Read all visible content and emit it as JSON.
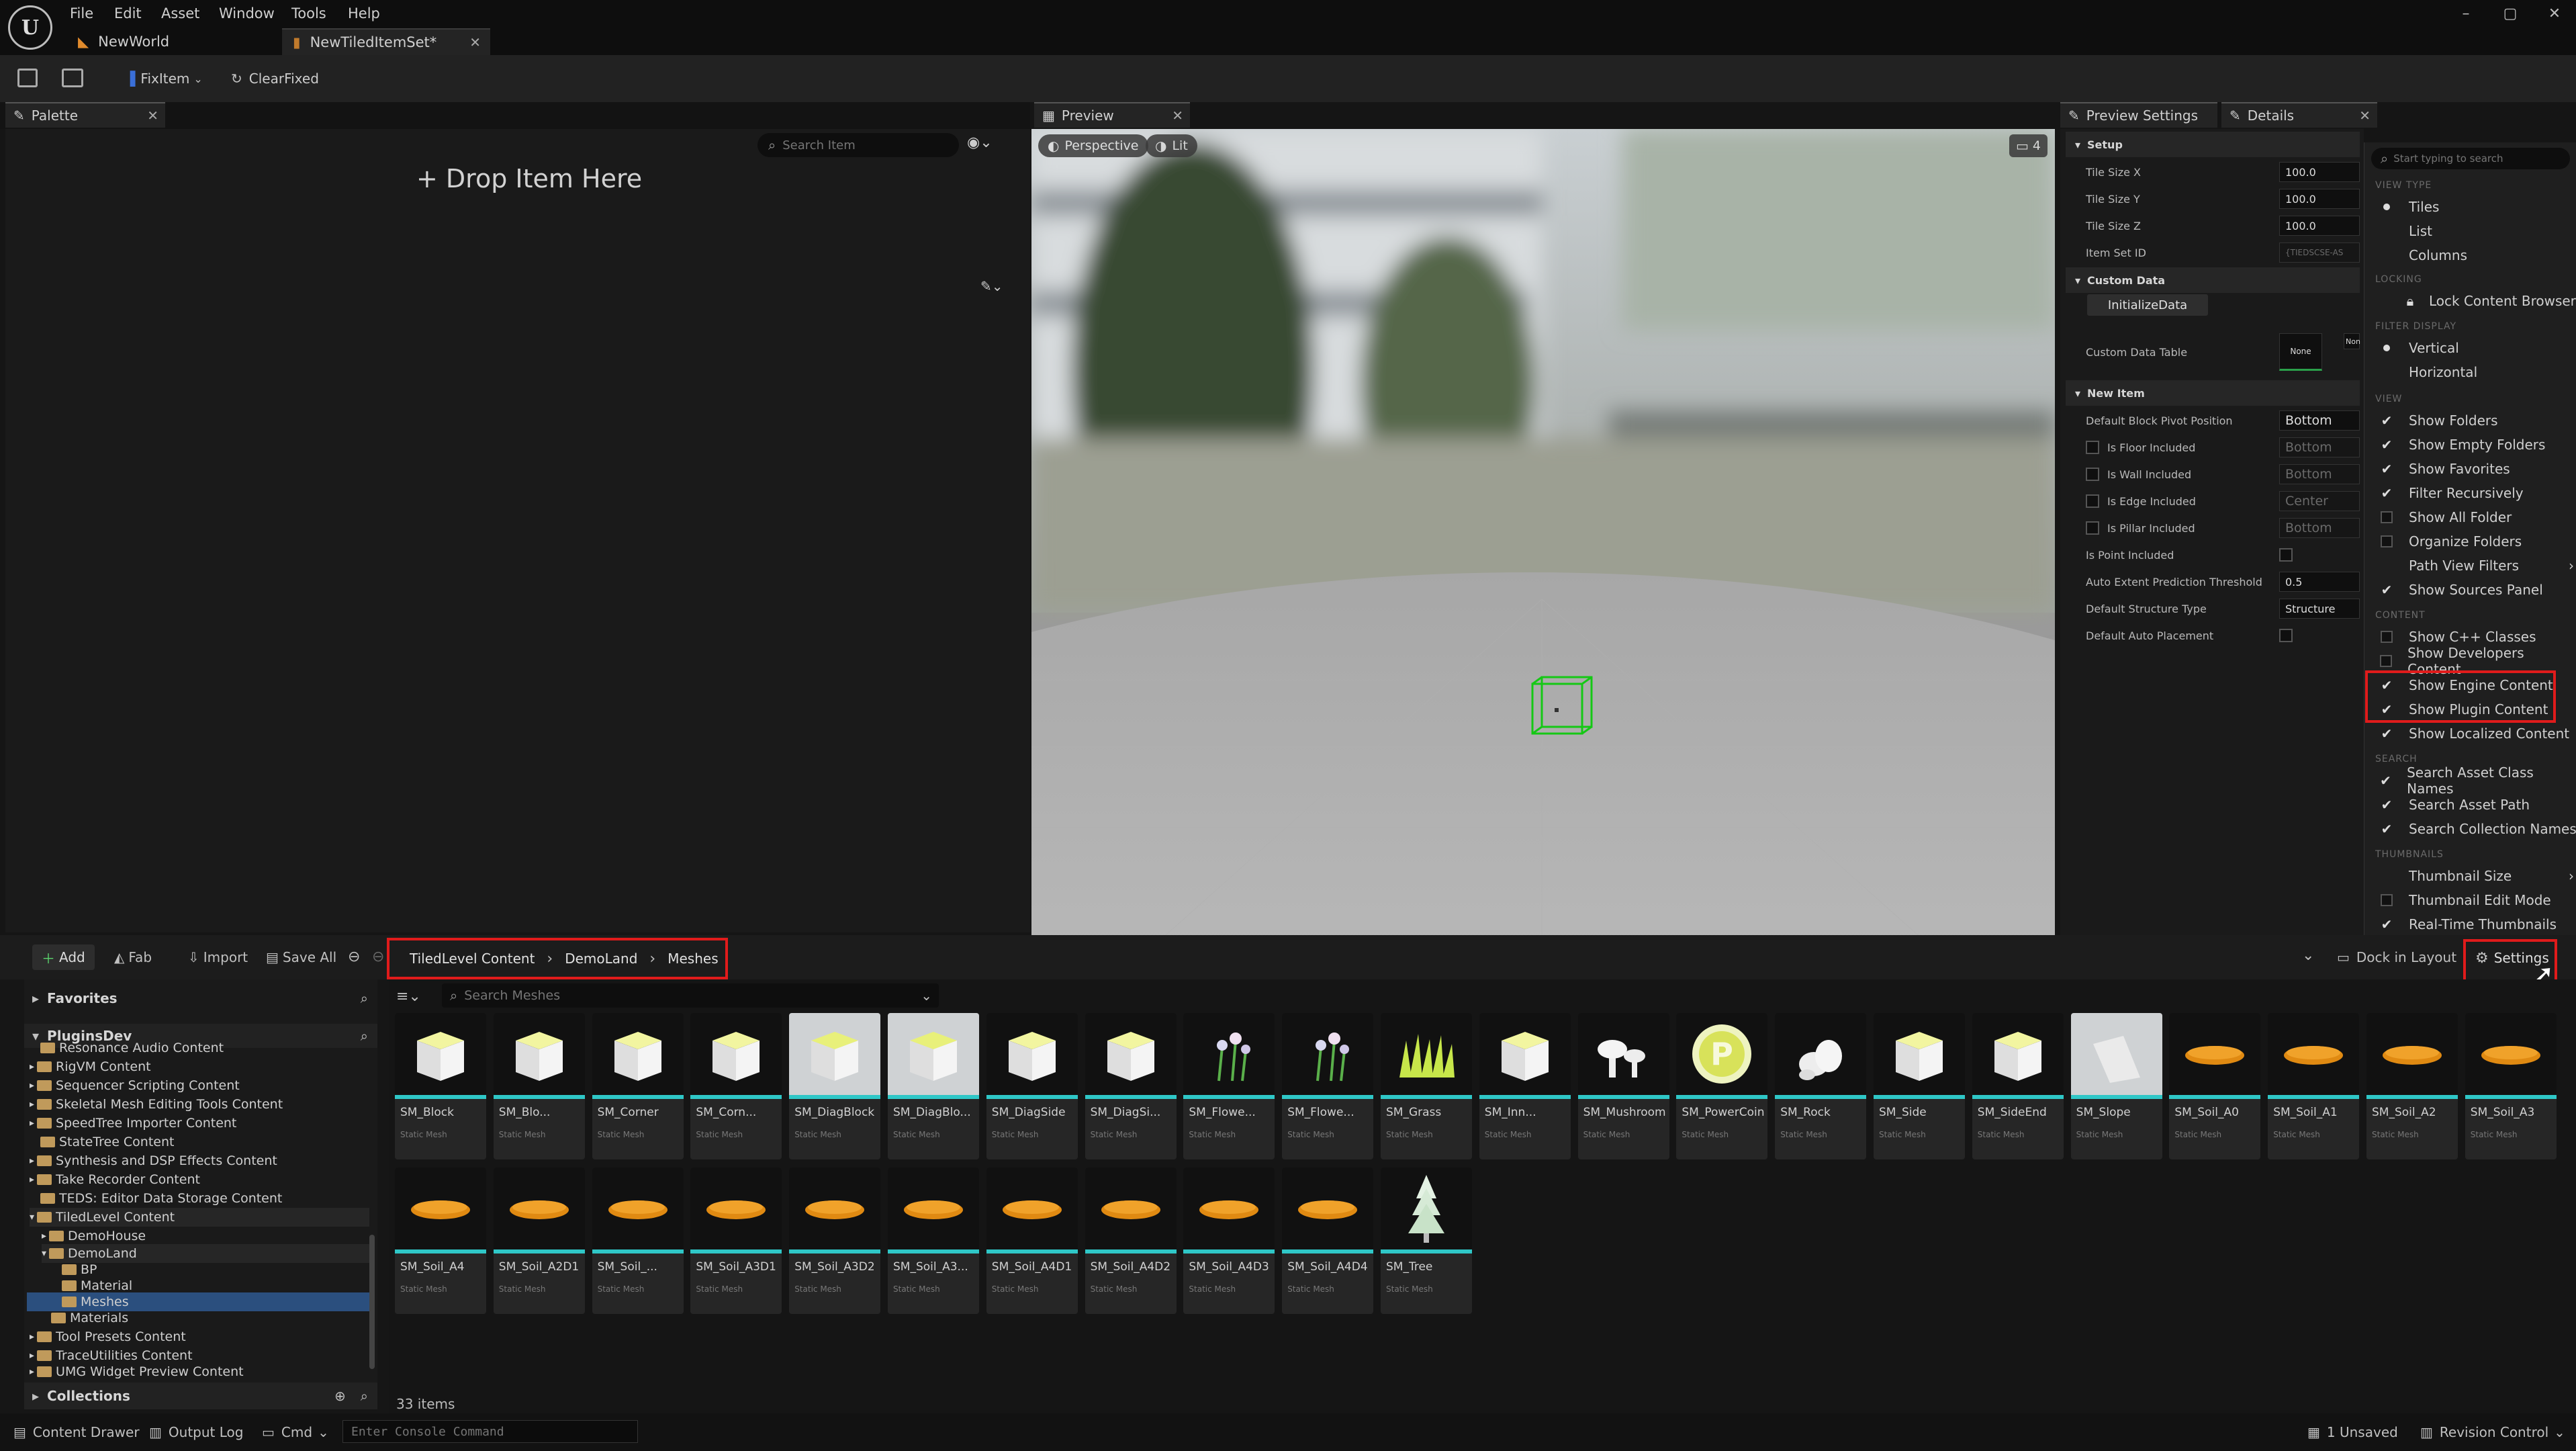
{
  "menu": [
    "File",
    "Edit",
    "Asset",
    "Window",
    "Tools",
    "Help"
  ],
  "doc_tabs": [
    {
      "label": "NewWorld"
    },
    {
      "label": "NewTiledItemSet*"
    }
  ],
  "toolbar": {
    "fix_item": "FixItem",
    "clear_fixed": "ClearFixed"
  },
  "palette": {
    "tab": "Palette",
    "search_placeholder": "Search Item",
    "drop_label": "+ Drop Item Here"
  },
  "preview": {
    "tab": "Preview",
    "perspective": "Perspective",
    "lit": "Lit",
    "camera_speed": "4"
  },
  "details": {
    "tab_preview_settings": "Preview Settings",
    "tab_details": "Details",
    "sections": {
      "setup": "Setup",
      "custom_data": "Custom Data",
      "new_item": "New Item"
    },
    "rows": {
      "tile_size_x": {
        "label": "Tile Size X",
        "value": "100.0"
      },
      "tile_size_y": {
        "label": "Tile Size Y",
        "value": "100.0"
      },
      "tile_size_z": {
        "label": "Tile Size Z",
        "value": "100.0"
      },
      "item_set_id": {
        "label": "Item Set ID",
        "value": "{TIEDSCSE-AS"
      },
      "initialize": "InitializeData",
      "custom_data_table": {
        "label": "Custom Data Table",
        "value": "None",
        "extra": "Non"
      },
      "default_block_pivot": {
        "label": "Default Block Pivot Position",
        "value": "Bottom"
      },
      "is_floor": {
        "label": "Is Floor Included",
        "value": "Bottom"
      },
      "is_wall": {
        "label": "Is Wall Included",
        "value": "Bottom"
      },
      "is_edge": {
        "label": "Is Edge Included",
        "value": "Center"
      },
      "is_pillar": {
        "label": "Is Pillar Included",
        "value": "Bottom"
      },
      "is_point": {
        "label": "Is Point Included"
      },
      "auto_extent": {
        "label": "Auto Extent Prediction Threshold",
        "value": "0.5"
      },
      "structure_type": {
        "label": "Default Structure Type",
        "value": "Structure"
      },
      "auto_placement": {
        "label": "Default Auto Placement"
      }
    }
  },
  "settings_menu": {
    "search_placeholder": "Start typing to search",
    "headers": {
      "view_type": "VIEW TYPE",
      "locking": "LOCKING",
      "filter_display": "FILTER DISPLAY",
      "view": "VIEW",
      "content": "CONTENT",
      "search": "SEARCH",
      "thumbnails": "THUMBNAILS"
    },
    "items": {
      "tiles": "Tiles",
      "list": "List",
      "columns": "Columns",
      "lock": "Lock Content Browser",
      "vertical": "Vertical",
      "horizontal": "Horizontal",
      "show_folders": "Show Folders",
      "show_empty_folders": "Show Empty Folders",
      "show_favorites": "Show Favorites",
      "filter_recursively": "Filter Recursively",
      "show_all_folder": "Show All Folder",
      "organize_folders": "Organize Folders",
      "path_view_filters": "Path View Filters",
      "show_sources_panel": "Show Sources Panel",
      "show_cpp": "Show C++ Classes",
      "show_dev": "Show Developers Content",
      "show_engine": "Show Engine Content",
      "show_plugin": "Show Plugin Content",
      "show_localized": "Show Localized Content",
      "search_class": "Search Asset Class Names",
      "search_path": "Search Asset Path",
      "search_collection": "Search Collection Names",
      "thumb_size": "Thumbnail Size",
      "thumb_edit": "Thumbnail Edit Mode",
      "realtime": "Real-Time Thumbnails"
    }
  },
  "content_browser": {
    "add": "Add",
    "fab": "Fab",
    "import": "Import",
    "save_all": "Save All",
    "breadcrumb": [
      "TiledLevel Content",
      "DemoLand",
      "Meshes"
    ],
    "dock": "Dock in Layout",
    "settings": "Settings",
    "search_placeholder": "Search Meshes",
    "favorites": "Favorites",
    "plugins_dev": "PluginsDev",
    "collections": "Collections",
    "items_count": "33 items",
    "tree": [
      "Resonance Audio Content",
      "RigVM Content",
      "Sequencer Scripting Content",
      "Skeletal Mesh Editing Tools Content",
      "SpeedTree Importer Content",
      "StateTree Content",
      "Synthesis and DSP Effects Content",
      "Take Recorder Content",
      "TEDS: Editor Data Storage Content",
      "TiledLevel Content",
      "DemoHouse",
      "DemoLand",
      "BP",
      "Material",
      "Meshes",
      "Materials",
      "Tool Presets Content",
      "TraceUtilities Content",
      "UMG Widget Preview Content"
    ],
    "asset_type": "Static Mesh",
    "assets": [
      "SM_Block",
      "SM_Blo...",
      "SM_Corner",
      "SM_Corn...",
      "SM_DiagBlock",
      "SM_DiagBlo...",
      "SM_DiagSide",
      "SM_DiagSi...",
      "SM_Flowe...",
      "SM_Flowe...",
      "SM_Grass",
      "SM_Inn...",
      "SM_Mushroom",
      "SM_PowerCoin",
      "SM_Rock",
      "SM_Side",
      "SM_SideEnd",
      "SM_Slope",
      "SM_Soil_A0",
      "SM_Soil_A1",
      "SM_Soil_A2",
      "SM_Soil_A3",
      "SM_Soil_A4",
      "SM_Soil_A2D1",
      "SM_Soil_...",
      "SM_Soil_A3D1",
      "SM_Soil_A3D2",
      "SM_Soil_A3...",
      "SM_Soil_A4D1",
      "SM_Soil_A4D2",
      "SM_Soil_A4D3",
      "SM_Soil_A4D4",
      "SM_Tree"
    ]
  },
  "statusbar": {
    "content_drawer": "Content Drawer",
    "output_log": "Output Log",
    "cmd": "Cmd",
    "console_placeholder": "Enter Console Command",
    "unsaved": "1 Unsaved",
    "revision": "Revision Control"
  },
  "colors": {
    "accent_cyan": "#2fc7c7",
    "highlight_red": "#e01b1b",
    "selection_blue": "#2b4f7e"
  }
}
